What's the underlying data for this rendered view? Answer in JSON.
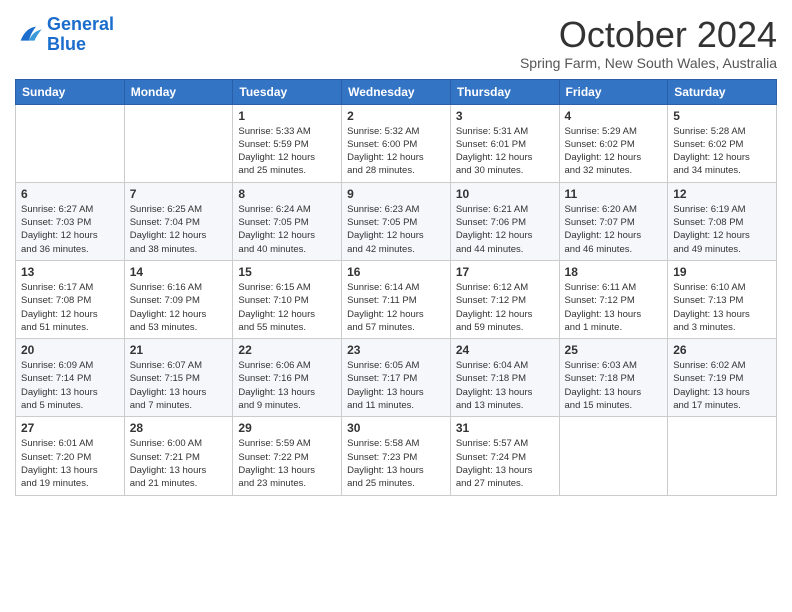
{
  "logo": {
    "text_general": "General",
    "text_blue": "Blue"
  },
  "header": {
    "month": "October 2024",
    "location": "Spring Farm, New South Wales, Australia"
  },
  "weekdays": [
    "Sunday",
    "Monday",
    "Tuesday",
    "Wednesday",
    "Thursday",
    "Friday",
    "Saturday"
  ],
  "weeks": [
    [
      {
        "day": "",
        "info": ""
      },
      {
        "day": "",
        "info": ""
      },
      {
        "day": "1",
        "info": "Sunrise: 5:33 AM\nSunset: 5:59 PM\nDaylight: 12 hours\nand 25 minutes."
      },
      {
        "day": "2",
        "info": "Sunrise: 5:32 AM\nSunset: 6:00 PM\nDaylight: 12 hours\nand 28 minutes."
      },
      {
        "day": "3",
        "info": "Sunrise: 5:31 AM\nSunset: 6:01 PM\nDaylight: 12 hours\nand 30 minutes."
      },
      {
        "day": "4",
        "info": "Sunrise: 5:29 AM\nSunset: 6:02 PM\nDaylight: 12 hours\nand 32 minutes."
      },
      {
        "day": "5",
        "info": "Sunrise: 5:28 AM\nSunset: 6:02 PM\nDaylight: 12 hours\nand 34 minutes."
      }
    ],
    [
      {
        "day": "6",
        "info": "Sunrise: 6:27 AM\nSunset: 7:03 PM\nDaylight: 12 hours\nand 36 minutes."
      },
      {
        "day": "7",
        "info": "Sunrise: 6:25 AM\nSunset: 7:04 PM\nDaylight: 12 hours\nand 38 minutes."
      },
      {
        "day": "8",
        "info": "Sunrise: 6:24 AM\nSunset: 7:05 PM\nDaylight: 12 hours\nand 40 minutes."
      },
      {
        "day": "9",
        "info": "Sunrise: 6:23 AM\nSunset: 7:05 PM\nDaylight: 12 hours\nand 42 minutes."
      },
      {
        "day": "10",
        "info": "Sunrise: 6:21 AM\nSunset: 7:06 PM\nDaylight: 12 hours\nand 44 minutes."
      },
      {
        "day": "11",
        "info": "Sunrise: 6:20 AM\nSunset: 7:07 PM\nDaylight: 12 hours\nand 46 minutes."
      },
      {
        "day": "12",
        "info": "Sunrise: 6:19 AM\nSunset: 7:08 PM\nDaylight: 12 hours\nand 49 minutes."
      }
    ],
    [
      {
        "day": "13",
        "info": "Sunrise: 6:17 AM\nSunset: 7:08 PM\nDaylight: 12 hours\nand 51 minutes."
      },
      {
        "day": "14",
        "info": "Sunrise: 6:16 AM\nSunset: 7:09 PM\nDaylight: 12 hours\nand 53 minutes."
      },
      {
        "day": "15",
        "info": "Sunrise: 6:15 AM\nSunset: 7:10 PM\nDaylight: 12 hours\nand 55 minutes."
      },
      {
        "day": "16",
        "info": "Sunrise: 6:14 AM\nSunset: 7:11 PM\nDaylight: 12 hours\nand 57 minutes."
      },
      {
        "day": "17",
        "info": "Sunrise: 6:12 AM\nSunset: 7:12 PM\nDaylight: 12 hours\nand 59 minutes."
      },
      {
        "day": "18",
        "info": "Sunrise: 6:11 AM\nSunset: 7:12 PM\nDaylight: 13 hours\nand 1 minute."
      },
      {
        "day": "19",
        "info": "Sunrise: 6:10 AM\nSunset: 7:13 PM\nDaylight: 13 hours\nand 3 minutes."
      }
    ],
    [
      {
        "day": "20",
        "info": "Sunrise: 6:09 AM\nSunset: 7:14 PM\nDaylight: 13 hours\nand 5 minutes."
      },
      {
        "day": "21",
        "info": "Sunrise: 6:07 AM\nSunset: 7:15 PM\nDaylight: 13 hours\nand 7 minutes."
      },
      {
        "day": "22",
        "info": "Sunrise: 6:06 AM\nSunset: 7:16 PM\nDaylight: 13 hours\nand 9 minutes."
      },
      {
        "day": "23",
        "info": "Sunrise: 6:05 AM\nSunset: 7:17 PM\nDaylight: 13 hours\nand 11 minutes."
      },
      {
        "day": "24",
        "info": "Sunrise: 6:04 AM\nSunset: 7:18 PM\nDaylight: 13 hours\nand 13 minutes."
      },
      {
        "day": "25",
        "info": "Sunrise: 6:03 AM\nSunset: 7:18 PM\nDaylight: 13 hours\nand 15 minutes."
      },
      {
        "day": "26",
        "info": "Sunrise: 6:02 AM\nSunset: 7:19 PM\nDaylight: 13 hours\nand 17 minutes."
      }
    ],
    [
      {
        "day": "27",
        "info": "Sunrise: 6:01 AM\nSunset: 7:20 PM\nDaylight: 13 hours\nand 19 minutes."
      },
      {
        "day": "28",
        "info": "Sunrise: 6:00 AM\nSunset: 7:21 PM\nDaylight: 13 hours\nand 21 minutes."
      },
      {
        "day": "29",
        "info": "Sunrise: 5:59 AM\nSunset: 7:22 PM\nDaylight: 13 hours\nand 23 minutes."
      },
      {
        "day": "30",
        "info": "Sunrise: 5:58 AM\nSunset: 7:23 PM\nDaylight: 13 hours\nand 25 minutes."
      },
      {
        "day": "31",
        "info": "Sunrise: 5:57 AM\nSunset: 7:24 PM\nDaylight: 13 hours\nand 27 minutes."
      },
      {
        "day": "",
        "info": ""
      },
      {
        "day": "",
        "info": ""
      }
    ]
  ]
}
